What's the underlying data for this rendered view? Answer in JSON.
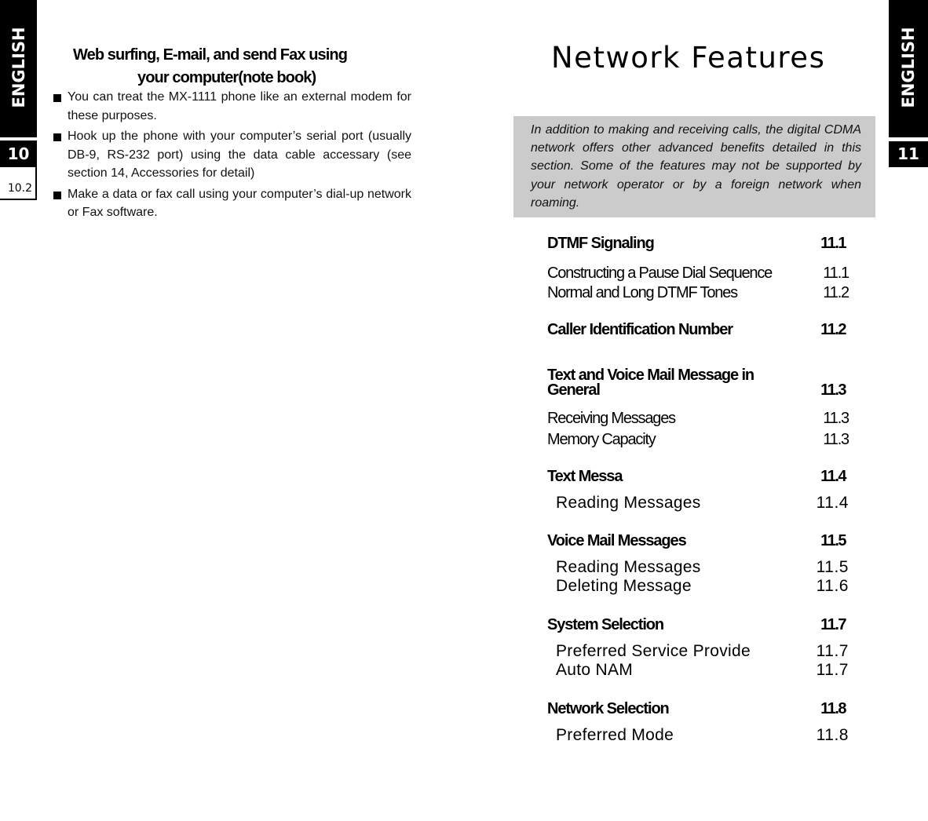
{
  "tabs": {
    "left_language": "ENGLISH",
    "left_chapter": "10",
    "left_page": "10.2",
    "right_language": "ENGLISH",
    "right_chapter": "11"
  },
  "left_page": {
    "heading_line1": "Web surfing, E-mail, and send Fax using",
    "heading_line2": "your computer(note book)",
    "bullets": [
      "You can treat the MX-1111 phone like an external modem for these purposes.",
      "Hook up the phone with your computer’s serial port (usually DB-9, RS-232 port) using the data cable accessary (see section 14, Accessories for detail)",
      "Make a data or fax call using your computer’s dial-up network or Fax software."
    ]
  },
  "right_page": {
    "title": "Network Features",
    "intro": "In addition to making and receiving calls, the digital CDMA network offers other advanced benefits detailed in this section. Some of the features may not be supported by your network operator or by a foreign network when roaming.",
    "toc": [
      {
        "title": "DTMF Signaling",
        "page": "11.1",
        "items": [
          {
            "title": "Constructing a Pause Dial Sequence",
            "page": "11.1"
          },
          {
            "title": "Normal and Long DTMF Tones",
            "page": "11.2"
          }
        ]
      },
      {
        "title": "Caller Identification Number",
        "page": "11.2",
        "items": []
      },
      {
        "title_line1": "Text and Voice Mail Message in",
        "title": "General",
        "page": "11.3",
        "items": [
          {
            "title": "Receiving Messages",
            "page": "11.3"
          },
          {
            "title": "Memory Capacity",
            "page": "11.3"
          }
        ]
      },
      {
        "title": "Text Messa",
        "page": "11.4",
        "items": [
          {
            "title": "Reading Messages",
            "page": "11.4"
          }
        ]
      },
      {
        "title": "Voice Mail Messages",
        "page": "11.5",
        "items": [
          {
            "title": "Reading Messages",
            "page": "11.5"
          },
          {
            "title": "Deleting Message",
            "page": "11.6"
          }
        ]
      },
      {
        "title": "System Selection",
        "page": "11.7",
        "items": [
          {
            "title": "Preferred Service Provide",
            "page": "11.7"
          },
          {
            "title": "Auto NAM",
            "page": "11.7"
          }
        ]
      },
      {
        "title": "Network Selection",
        "page": "11.8",
        "items": [
          {
            "title": "Preferred Mode",
            "page": "11.8"
          }
        ]
      }
    ]
  }
}
